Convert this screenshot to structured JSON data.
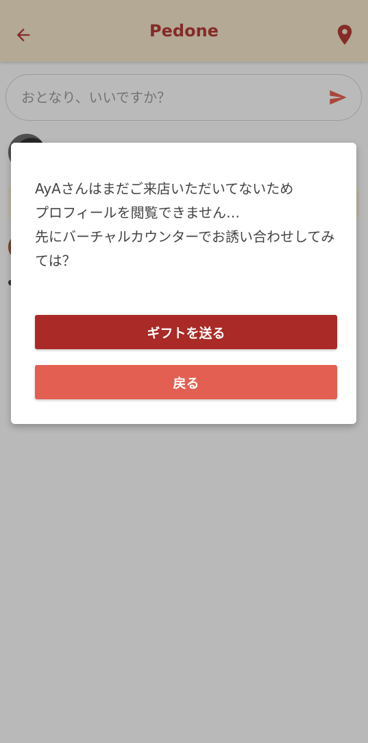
{
  "header": {
    "title": "Pedone",
    "back_icon": "arrow-left-icon",
    "location_icon": "map-pin-icon"
  },
  "search": {
    "placeholder": "おとなり、いいですか？",
    "send_icon": "send-icon"
  },
  "dialog": {
    "message": "AyAさんはまだご来店いただいてないため\nプロフィールを閲覧できません…\n先にバーチャルカウンターでお誘い合わせしてみては？",
    "primary_button": "ギフトを送る",
    "secondary_button": "戻る"
  },
  "colors": {
    "header_bg": "#efe2c7",
    "accent": "#b23a36",
    "primary_button": "#a92a26",
    "secondary_button": "#e35f51"
  }
}
